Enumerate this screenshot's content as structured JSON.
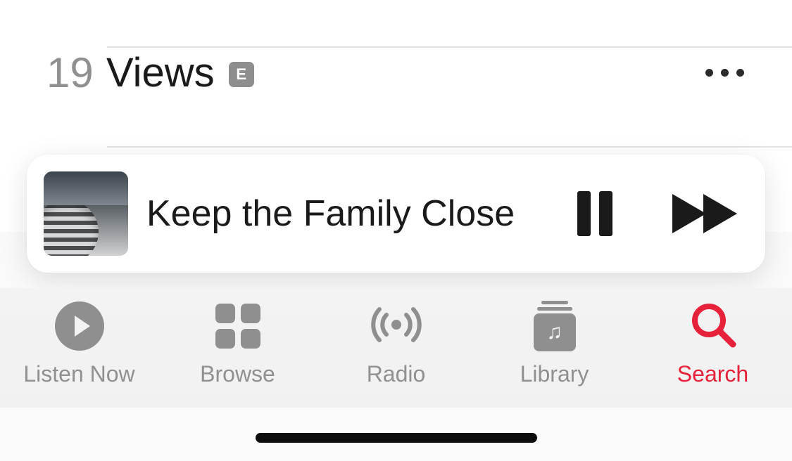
{
  "track": {
    "number": "19",
    "title": "Views",
    "explicit_label": "E"
  },
  "now_playing": {
    "title": "Keep the Family Close"
  },
  "tabs": [
    {
      "id": "listen-now",
      "label": "Listen Now",
      "active": false
    },
    {
      "id": "browse",
      "label": "Browse",
      "active": false
    },
    {
      "id": "radio",
      "label": "Radio",
      "active": false
    },
    {
      "id": "library",
      "label": "Library",
      "active": false
    },
    {
      "id": "search",
      "label": "Search",
      "active": true
    }
  ],
  "colors": {
    "accent": "#e6223a",
    "inactive": "#909090"
  }
}
